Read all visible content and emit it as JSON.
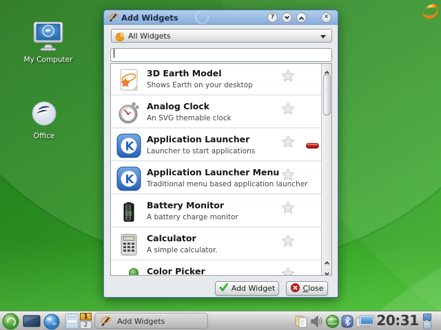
{
  "desktop": {
    "icons": [
      {
        "label": "My Computer",
        "icon": "computer-monitor"
      },
      {
        "label": "Office",
        "icon": "office-suite"
      }
    ],
    "corner_toolbox_icon": "plasma-cashew"
  },
  "window": {
    "title": "Add Widgets",
    "titlebar": {
      "help_glyph": "?",
      "close_glyph": "✕"
    },
    "filter": {
      "value": "All Widgets",
      "icon": "plasma-logo"
    },
    "search": {
      "value": ""
    },
    "widgets": [
      {
        "name": "3D Earth Model",
        "description": "Shows Earth on your desktop",
        "icon": "earth-document"
      },
      {
        "name": "Analog Clock",
        "description": "An SVG themable clock",
        "icon": "stopwatch"
      },
      {
        "name": "Application Launcher",
        "description": "Launcher to start applications",
        "icon": "kde-logo",
        "in_use": true
      },
      {
        "name": "Application Launcher Menu",
        "description": "Traditional menu based application launcher",
        "icon": "kde-logo"
      },
      {
        "name": "Battery Monitor",
        "description": "A battery charge monitor",
        "icon": "battery"
      },
      {
        "name": "Calculator",
        "description": "A simple calculator.",
        "icon": "calculator"
      },
      {
        "name": "Color Picker",
        "description": "",
        "icon": "color-picker"
      }
    ],
    "buttons": {
      "add": "Add Widget",
      "close_mnemonic": "C",
      "close_rest": "lose"
    }
  },
  "panel": {
    "launcher_icons": [
      "kickoff-menu",
      "show-desktop",
      "web-browser",
      "file-manager"
    ],
    "pager": {
      "desktop1": "1",
      "desktop2": "2"
    },
    "task": {
      "label": "Add Widgets",
      "icon": "magic-wand"
    },
    "tray_icons": [
      "clipboard",
      "volume",
      "network",
      "bluetooth-device",
      "device-notifier"
    ],
    "clock": "20:31"
  }
}
